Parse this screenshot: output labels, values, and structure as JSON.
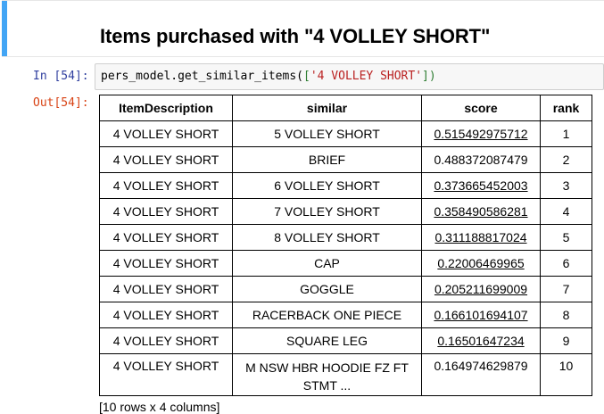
{
  "markdown": {
    "heading": "Items purchased with \"4 VOLLEY SHORT\""
  },
  "input_cell": {
    "prompt": "In [54]:",
    "code_func": "pers_model.get_similar_items",
    "code_open_paren": "(",
    "code_open_bracket": "[",
    "code_string": "'4 VOLLEY SHORT'",
    "code_close_bracket": "]",
    "code_close_paren": ")"
  },
  "output_cell": {
    "prompt": "Out[54]:",
    "columns": [
      "ItemDescription",
      "similar",
      "score",
      "rank"
    ],
    "rows": [
      [
        "4 VOLLEY SHORT",
        "5 VOLLEY SHORT",
        "0.515492975712",
        "1"
      ],
      [
        "4 VOLLEY SHORT",
        "BRIEF",
        "0.488372087479",
        "2"
      ],
      [
        "4 VOLLEY SHORT",
        "6 VOLLEY SHORT",
        "0.373665452003",
        "3"
      ],
      [
        "4 VOLLEY SHORT",
        "7 VOLLEY SHORT",
        "0.358490586281",
        "4"
      ],
      [
        "4 VOLLEY SHORT",
        "8 VOLLEY SHORT",
        "0.311188817024",
        "5"
      ],
      [
        "4 VOLLEY SHORT",
        "CAP",
        "0.22006469965",
        "6"
      ],
      [
        "4 VOLLEY SHORT",
        "GOGGLE",
        "0.205211699009",
        "7"
      ],
      [
        "4 VOLLEY SHORT",
        "RACERBACK ONE PIECE",
        "0.166101694107",
        "8"
      ],
      [
        "4 VOLLEY SHORT",
        "SQUARE LEG",
        "0.16501647234",
        "9"
      ],
      [
        "4 VOLLEY SHORT",
        "M NSW HBR HOODIE FZ FT STMT ...",
        "0.164974629879",
        "10"
      ]
    ],
    "underlined_score_rows": [
      0,
      2,
      3,
      4,
      5,
      6,
      7,
      8
    ],
    "footer": "[10 rows x 4 columns]"
  },
  "colors": {
    "selection_bar": "#42a5f5",
    "in_prompt": "#303f9f",
    "out_prompt": "#d84315",
    "code_string": "#ba2121",
    "code_bracket": "#2e7d32"
  }
}
